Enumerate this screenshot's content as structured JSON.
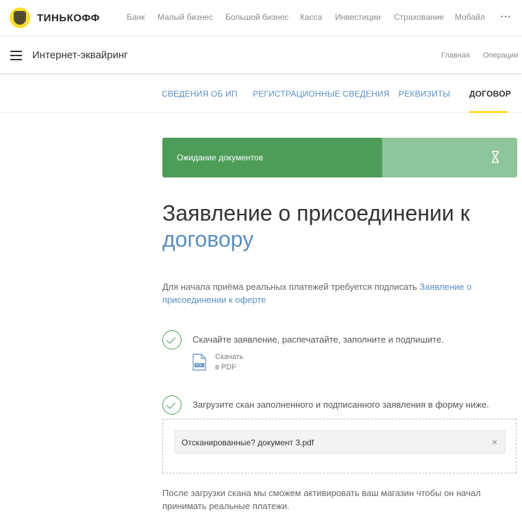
{
  "brand": {
    "name": "ТИНЬКОФФ",
    "accent": "#ffdd2d",
    "success": "#4e9c58",
    "link": "#5b8ec0"
  },
  "topnav": {
    "items": [
      "Банк",
      "Малый бизнес",
      "Большой бизнес",
      "Касса",
      "Инвестиции",
      "Страхование",
      "Мобайл"
    ],
    "more_icon": "⋯"
  },
  "subbar": {
    "title": "Интернет-эквайринг",
    "links": [
      "Главная",
      "Операции"
    ]
  },
  "tabs": [
    {
      "label": "СВЕДЕНИЯ ОБ ИП"
    },
    {
      "label": "РЕГИСТРАЦИОННЫЕ СВЕДЕНИЯ"
    },
    {
      "label": "РЕКВИЗИТЫ"
    },
    {
      "label": "ДОГОВОР",
      "active": true
    }
  ],
  "status": {
    "text": "Ожидание документов",
    "icon": "hourglass-icon"
  },
  "heading": {
    "part1": "Заявление о присоединении к",
    "part2": "договору"
  },
  "intro": {
    "plain": "Для начала приёма реальных платежей требуется подписать ",
    "link": "Заявление о присоединении к оферте"
  },
  "steps": [
    {
      "text": "Скачайте заявление, распечатайте, заполните и подпишите."
    },
    {
      "text": "Загрузите скан заполненного и подписанного заявления в форму ниже."
    }
  ],
  "download": {
    "line1": "Скачать",
    "line2": "в PDF",
    "icon_label": "PDF"
  },
  "upload": {
    "file_name": "Отсканированные? документ 3.pdf",
    "close": "×"
  },
  "after_text": "После загрузки скана мы сможем активировать ваш магазин чтобы он начал принимать реальные платежи."
}
